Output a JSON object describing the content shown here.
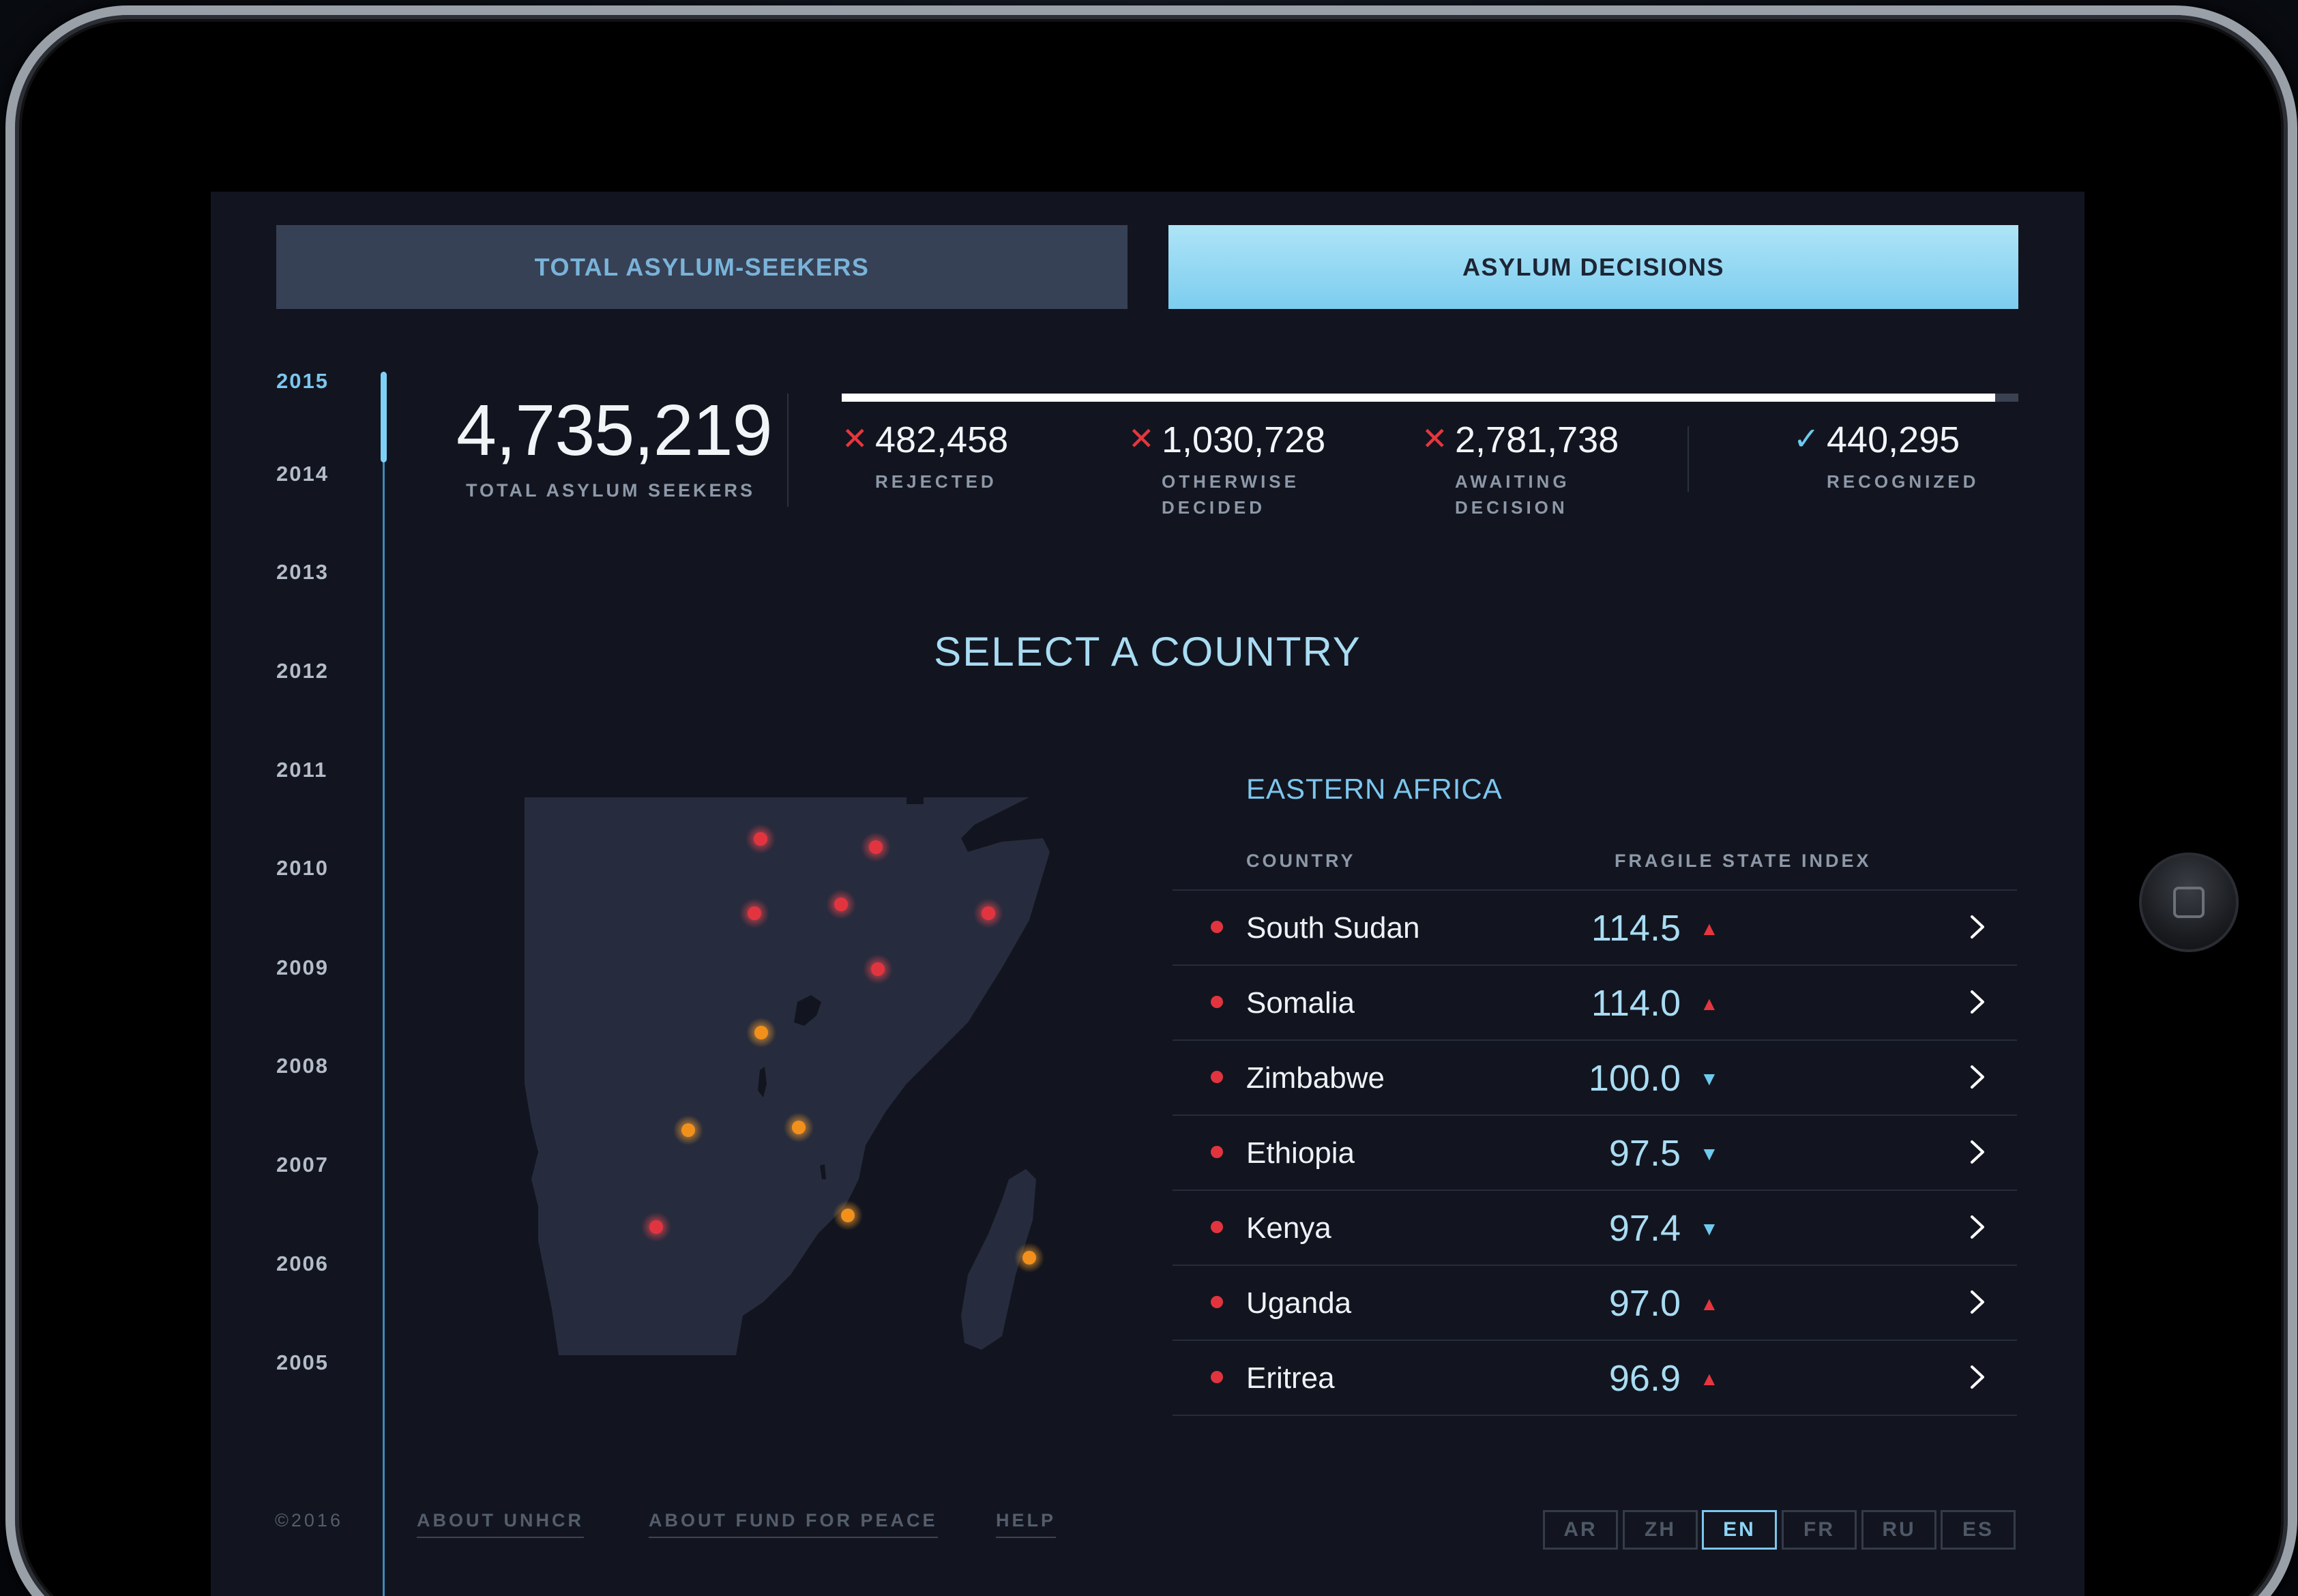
{
  "tabs": {
    "total": "TOTAL ASYLUM-SEEKERS",
    "decisions": "ASYLUM DECISIONS"
  },
  "years": [
    "2015",
    "2014",
    "2013",
    "2012",
    "2011",
    "2010",
    "2009",
    "2008",
    "2007",
    "2006",
    "2005"
  ],
  "selected_year": "2015",
  "totals": {
    "number": "4,735,219",
    "label": "TOTAL ASYLUM SEEKERS"
  },
  "decisions_progress": 0.98,
  "stats": [
    {
      "number": "482,458",
      "label": "REJECTED",
      "mark": "x-icon"
    },
    {
      "number": "1,030,728",
      "label": "OTHERWISE DECIDED",
      "mark": "x-icon"
    },
    {
      "number": "2,781,738",
      "label": "AWAITING DECISION",
      "mark": "x-icon"
    },
    {
      "number": "440,295",
      "label": "RECOGNIZED",
      "mark": "check-icon"
    }
  ],
  "heading": "SELECT A COUNTRY",
  "table": {
    "region": "EASTERN AFRICA",
    "col_country": "COUNTRY",
    "col_fsi": "FRAGILE STATE INDEX",
    "rows": [
      {
        "country": "South Sudan",
        "value": "114.5",
        "trend": "up"
      },
      {
        "country": "Somalia",
        "value": "114.0",
        "trend": "up"
      },
      {
        "country": "Zimbabwe",
        "value": "100.0",
        "trend": "down"
      },
      {
        "country": "Ethiopia",
        "value": "97.5",
        "trend": "down"
      },
      {
        "country": "Kenya",
        "value": "97.4",
        "trend": "down"
      },
      {
        "country": "Uganda",
        "value": "97.0",
        "trend": "up"
      },
      {
        "country": "Eritrea",
        "value": "96.9",
        "trend": "up"
      }
    ]
  },
  "colors": {
    "accent": "#7cc6ef",
    "alert": "#e6363e",
    "marker_red": "#e2343f",
    "marker_orange": "#f2901c",
    "screen_bg": "#12151f",
    "land": "#262c3d"
  },
  "footer": {
    "copyright": "©2016",
    "links": [
      "ABOUT UNHCR",
      "ABOUT FUND FOR PEACE",
      "HELP"
    ],
    "languages": [
      "AR",
      "ZH",
      "EN",
      "FR",
      "RU",
      "ES"
    ],
    "active_language": "EN"
  }
}
